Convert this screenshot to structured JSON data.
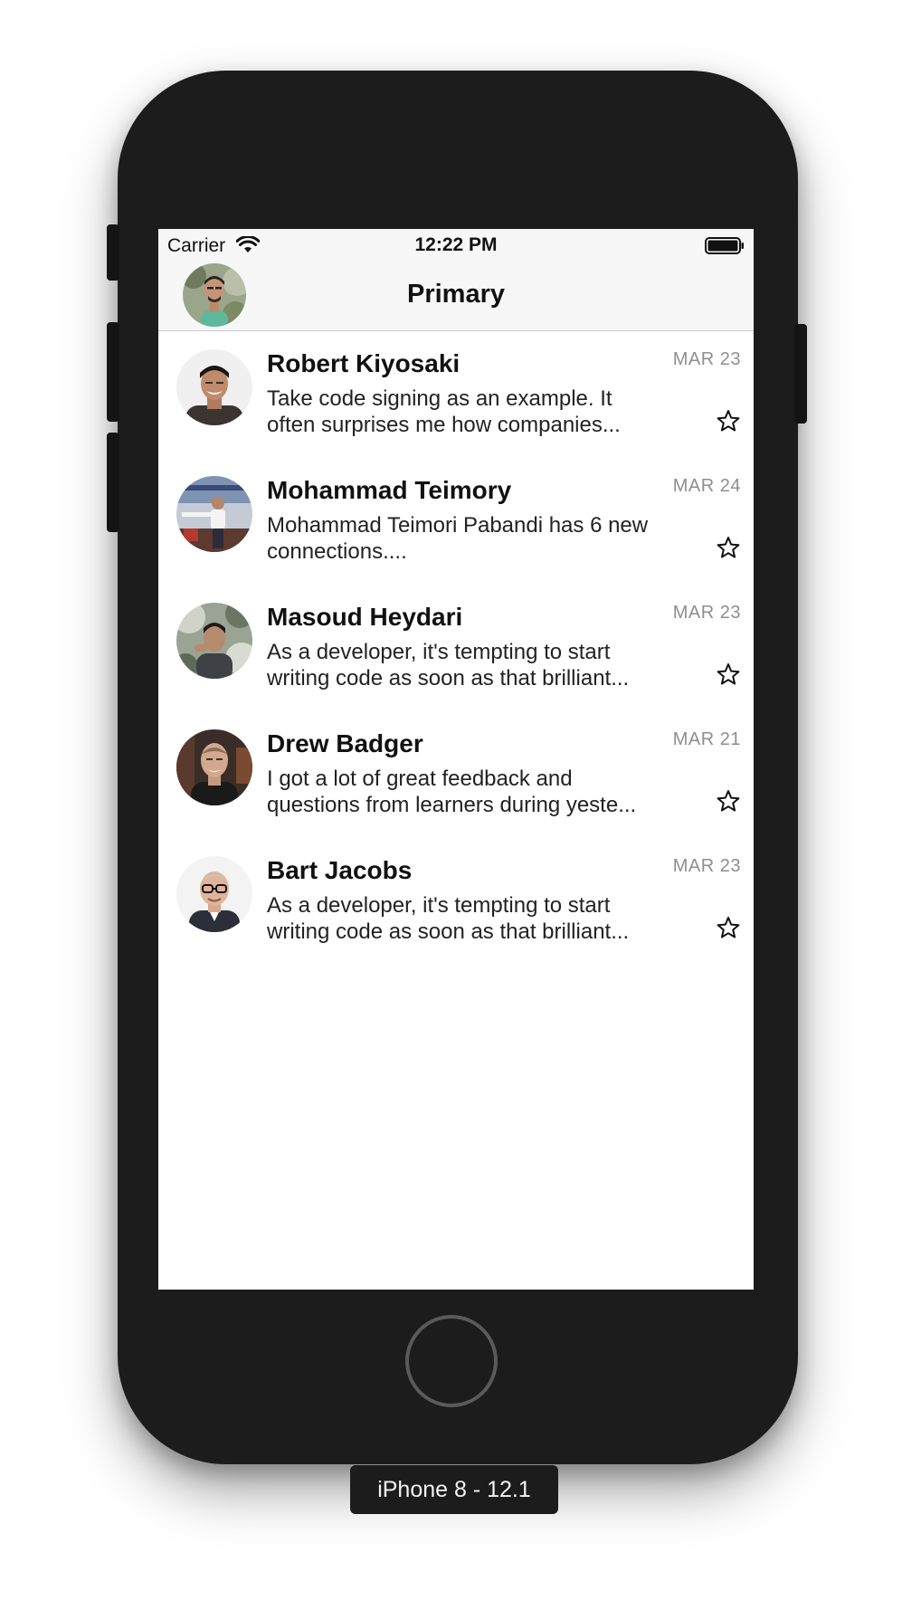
{
  "status_bar": {
    "carrier": "Carrier",
    "time": "12:22 PM"
  },
  "nav": {
    "title": "Primary",
    "profile_avatar_icon": "user-avatar-icon"
  },
  "messages": [
    {
      "sender": "Robert Kiyosaki",
      "date": "MAR 23",
      "preview": "Take code signing as an example. It often surprises me how companies..."
    },
    {
      "sender": "Mohammad Teimory",
      "date": "MAR 24",
      "preview": "Mohammad Teimori Pabandi has 6 new connections...."
    },
    {
      "sender": "Masoud Heydari",
      "date": "MAR 23",
      "preview": "As a developer, it's tempting to start writing code as soon as that brilliant..."
    },
    {
      "sender": "Drew Badger",
      "date": "MAR 21",
      "preview": "I got a lot of great feedback and questions from learners during yeste..."
    },
    {
      "sender": "Bart Jacobs",
      "date": "MAR 23",
      "preview": "As a developer, it's tempting to start writing code as soon as that brilliant..."
    }
  ],
  "device": {
    "label": "iPhone 8 - 12.1"
  },
  "colors": {
    "bar_background": "#f7f7f7",
    "date_gray": "#8e8e93",
    "phone_body": "#1c1c1c"
  }
}
